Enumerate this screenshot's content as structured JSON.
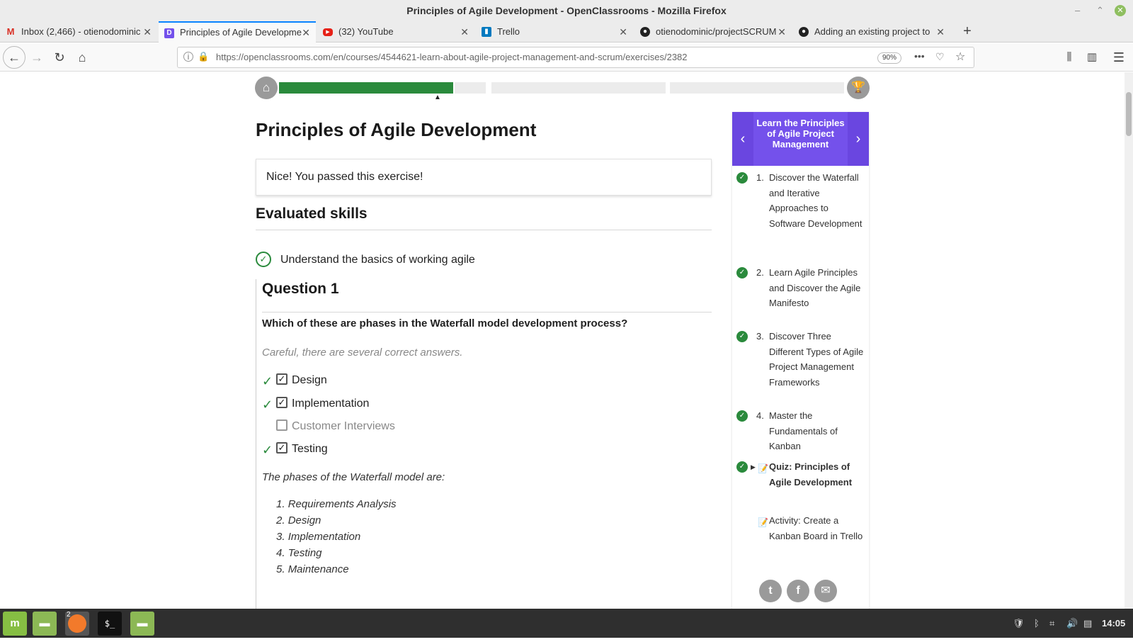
{
  "window": {
    "title": "Principles of Agile Development - OpenClassrooms - Mozilla Firefox"
  },
  "tabs": [
    {
      "label": "Inbox (2,466) - otienodominic",
      "icon": "gmail-icon",
      "active": false
    },
    {
      "label": "Principles of Agile Developme",
      "icon": "openclassrooms-icon",
      "active": true
    },
    {
      "label": "(32) YouTube",
      "icon": "youtube-icon",
      "active": false
    },
    {
      "label": "Trello",
      "icon": "trello-icon",
      "active": false
    },
    {
      "label": "otienodominic/projectSCRUM",
      "icon": "github-icon",
      "active": false
    },
    {
      "label": "Adding an existing project to",
      "icon": "github-icon",
      "active": false
    }
  ],
  "nav": {
    "url": "https://openclassrooms.com/en/courses/4544621-learn-about-agile-project-management-and-scrum/exercises/2382",
    "zoom": "90%"
  },
  "page": {
    "progress": {
      "done_fraction": 0.345
    },
    "title": "Principles of Agile Development",
    "pass_message": "Nice! You passed this exercise!",
    "evaluated_heading": "Evaluated skills",
    "skill": "Understand the basics of working agile",
    "question_title": "Question 1",
    "question_text": "Which of these are phases in the Waterfall model development process?",
    "careful": "Careful, there are several correct answers.",
    "answers": [
      {
        "label": "Design",
        "checked": true,
        "correct": true
      },
      {
        "label": "Implementation",
        "checked": true,
        "correct": true
      },
      {
        "label": "Customer Interviews",
        "checked": false,
        "correct": false
      },
      {
        "label": "Testing",
        "checked": true,
        "correct": true
      }
    ],
    "explanation": "The phases of the Waterfall model are:",
    "phases": [
      "Requirements Analysis",
      "Design",
      "Implementation",
      "Testing",
      "Maintenance"
    ]
  },
  "sidebar": {
    "title": "Learn the Principles of Agile Project Management",
    "items": [
      {
        "num": "1.",
        "label": "Discover the Waterfall and Iterative Approaches to Software Development",
        "done": true
      },
      {
        "num": "2.",
        "label": "Learn Agile Principles and Discover the Agile Manifesto",
        "done": true
      },
      {
        "num": "3.",
        "label": "Discover Three Different Types of Agile Project Management Frameworks",
        "done": true
      },
      {
        "num": "4.",
        "label": "Master the Fundamentals of Kanban",
        "done": true
      },
      {
        "num": "",
        "label": "Quiz: Principles of Agile Development",
        "done": true,
        "current": true
      },
      {
        "num": "",
        "label": "Activity: Create a Kanban Board in Trello",
        "done": false
      }
    ]
  },
  "taskbar": {
    "clock": "14:05",
    "firefox_badge": "2"
  }
}
